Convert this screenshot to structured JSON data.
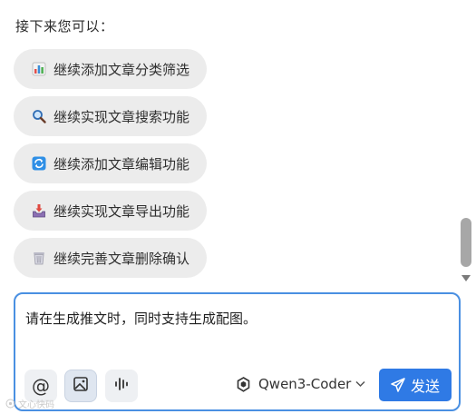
{
  "intro": "接下来您可以：",
  "suggestions": [
    {
      "icon": "bar-chart-icon",
      "label": "继续添加文章分类筛选"
    },
    {
      "icon": "magnifier-icon",
      "label": "继续实现文章搜索功能"
    },
    {
      "icon": "refresh-icon",
      "label": "继续添加文章编辑功能"
    },
    {
      "icon": "inbox-tray-icon",
      "label": "继续实现文章导出功能"
    },
    {
      "icon": "wastebasket-icon",
      "label": "继续完善文章删除确认"
    }
  ],
  "composer": {
    "text": "请在生成推文时，同时支持生成配图。",
    "model": "Qwen3-Coder",
    "send_label": "发送",
    "at_symbol": "@"
  },
  "watermark": "文心快码"
}
